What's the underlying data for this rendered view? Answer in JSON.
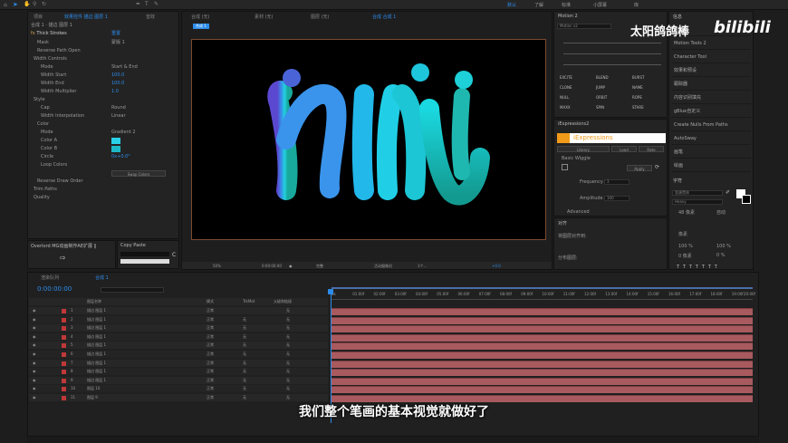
{
  "toolbar": {
    "right_items": [
      "默认",
      "了解",
      "标准",
      "小屏幕",
      "库"
    ]
  },
  "effect_controls": {
    "tabs": [
      "项目",
      "效果控件 描边 图层 1",
      "音效"
    ],
    "breadcrumb": "合成 1 · 描边 图层 1",
    "effect_name": "Thick Strokes",
    "reset_label": "重置",
    "rows": [
      {
        "label": "Mask",
        "value": "蒙版 1"
      },
      {
        "label": "Reverse Path Open",
        "value": ""
      },
      {
        "label": "Width Controls",
        "value": ""
      },
      {
        "label": "Mode",
        "value": "Start & End"
      },
      {
        "label": "Width Start",
        "value": "100.0"
      },
      {
        "label": "Width End",
        "value": "100.0"
      },
      {
        "label": "Width Multiplier",
        "value": "1.0"
      },
      {
        "label": "Style",
        "value": ""
      },
      {
        "label": "Cap",
        "value": "Round"
      },
      {
        "label": "Width Interpolation",
        "value": "Linear"
      },
      {
        "label": "Color",
        "value": ""
      },
      {
        "label": "Mode",
        "value": "Gradient 2"
      },
      {
        "label": "Color A",
        "value": ""
      },
      {
        "label": "Color B",
        "value": ""
      },
      {
        "label": "Circle",
        "value": "0x+0.0°"
      },
      {
        "label": "Loop Colors",
        "value": ""
      },
      {
        "label": "",
        "value": "Swap Colors"
      },
      {
        "label": "Reverse Draw Order",
        "value": ""
      },
      {
        "label": "Trim Paths",
        "value": ""
      },
      {
        "label": "Quality",
        "value": ""
      }
    ]
  },
  "mini_panels": {
    "overlord": "Overlord MG动画制作AE扩展 ‖",
    "copy_paste": "Copy Paste"
  },
  "composition": {
    "tabs": [
      "合成 1",
      "合成 (无)",
      "素材 (无)",
      "图层 (无)"
    ],
    "active_tab": "合成 合成 1",
    "sub_tab": "合成 1",
    "artwork_text": "nili",
    "footer": {
      "zoom": "50%",
      "timecode": "0:00:00:00",
      "quality": "完整",
      "camera": "活动摄像机",
      "views": "1个...",
      "offset": "+0.0"
    }
  },
  "motion_panel": {
    "title": "Motion 2",
    "tab": "Motion v2",
    "buttons_col1": [
      "EXCITE",
      "CLONE",
      "NULL",
      "MAXX"
    ],
    "buttons_col2": [
      "BLEND",
      "JUMP",
      "ORBIT",
      "SPIN"
    ],
    "buttons_col3": [
      "BURST",
      "NAME",
      "ROPE",
      "STARE"
    ]
  },
  "iexpressions": {
    "panel_title": "iExpressions2",
    "logo_text": "iExpressions",
    "buttons": [
      "Library",
      "Load",
      "Rate"
    ],
    "preset": "Basic Wiggle",
    "apply_label": "Apply",
    "frequency_label": "Frequency",
    "frequency_value": "3",
    "amplitude_label": "Amplitude",
    "amplitude_value": "100",
    "advanced_label": "Advanced"
  },
  "align_panel": {
    "title": "对齐",
    "items": [
      "将图层对齐到:",
      "分布图层:"
    ]
  },
  "right_panel": {
    "header": "信息",
    "items": [
      "预览",
      "Motion Tools 2",
      "Character Tool",
      "效果和预设",
      "跟踪器",
      "内容识别填充",
      "gBlue自定义",
      "Create Nulls From Paths",
      "AutoSway",
      "画笔",
      "绘画"
    ],
    "character_title": "字符",
    "font_name": "思源黑体",
    "font_style": "Heavy",
    "size_label": "48 像素",
    "leading_label": "自动",
    "tracking_label": "像素",
    "scale_v": "100 %",
    "scale_h": "100 %",
    "baseline": "0 像素",
    "tsume": "0 %"
  },
  "timeline": {
    "tabs": [
      "渲染队列",
      "合成 1"
    ],
    "timecode": "0:00:00:00",
    "columns": [
      "图层名称",
      "模式",
      "TrkMat",
      "父级和链接"
    ],
    "ruler": [
      "0s",
      "01:00f",
      "02:00f",
      "03:00f",
      "04:00f",
      "05:00f",
      "06:00f",
      "07:00f",
      "08:00f",
      "09:00f",
      "10:00f",
      "11:00f",
      "12:00f",
      "13:00f",
      "14:00f",
      "15:00f",
      "16:00f",
      "17:00f",
      "18:00f",
      "19:00f",
      "20:00f"
    ],
    "layers": [
      {
        "num": "1",
        "name": "描边 图层 1",
        "mode": "正常",
        "trk": "",
        "parent": "无"
      },
      {
        "num": "2",
        "name": "描边 图层 1",
        "mode": "正常",
        "trk": "无",
        "parent": "无"
      },
      {
        "num": "3",
        "name": "描边 图层 1",
        "mode": "正常",
        "trk": "无",
        "parent": "无"
      },
      {
        "num": "4",
        "name": "描边 图层 1",
        "mode": "正常",
        "trk": "无",
        "parent": "无"
      },
      {
        "num": "5",
        "name": "描边 图层 1",
        "mode": "正常",
        "trk": "无",
        "parent": "无"
      },
      {
        "num": "6",
        "name": "描边 图层 1",
        "mode": "正常",
        "trk": "无",
        "parent": "无"
      },
      {
        "num": "7",
        "name": "描边 图层 1",
        "mode": "正常",
        "trk": "无",
        "parent": "无"
      },
      {
        "num": "8",
        "name": "描边 图层 1",
        "mode": "正常",
        "trk": "无",
        "parent": "无"
      },
      {
        "num": "9",
        "name": "描边 图层 1",
        "mode": "正常",
        "trk": "无",
        "parent": "无"
      },
      {
        "num": "10",
        "name": "图层 10",
        "mode": "正常",
        "trk": "无",
        "parent": "无"
      },
      {
        "num": "11",
        "name": "图层 9",
        "mode": "正常",
        "trk": "无",
        "parent": "无"
      }
    ]
  },
  "subtitle": "我们整个笔画的基本视觉就做好了",
  "watermark": {
    "channel": "太阳鸽鸽棒",
    "logo": "bilibili"
  },
  "colors": {
    "accent": "#2d8ceb",
    "track": "#a85a5e",
    "playhead": "#2d8ceb",
    "color_a": "#2ad0e8",
    "color_b": "#1db8c8"
  }
}
